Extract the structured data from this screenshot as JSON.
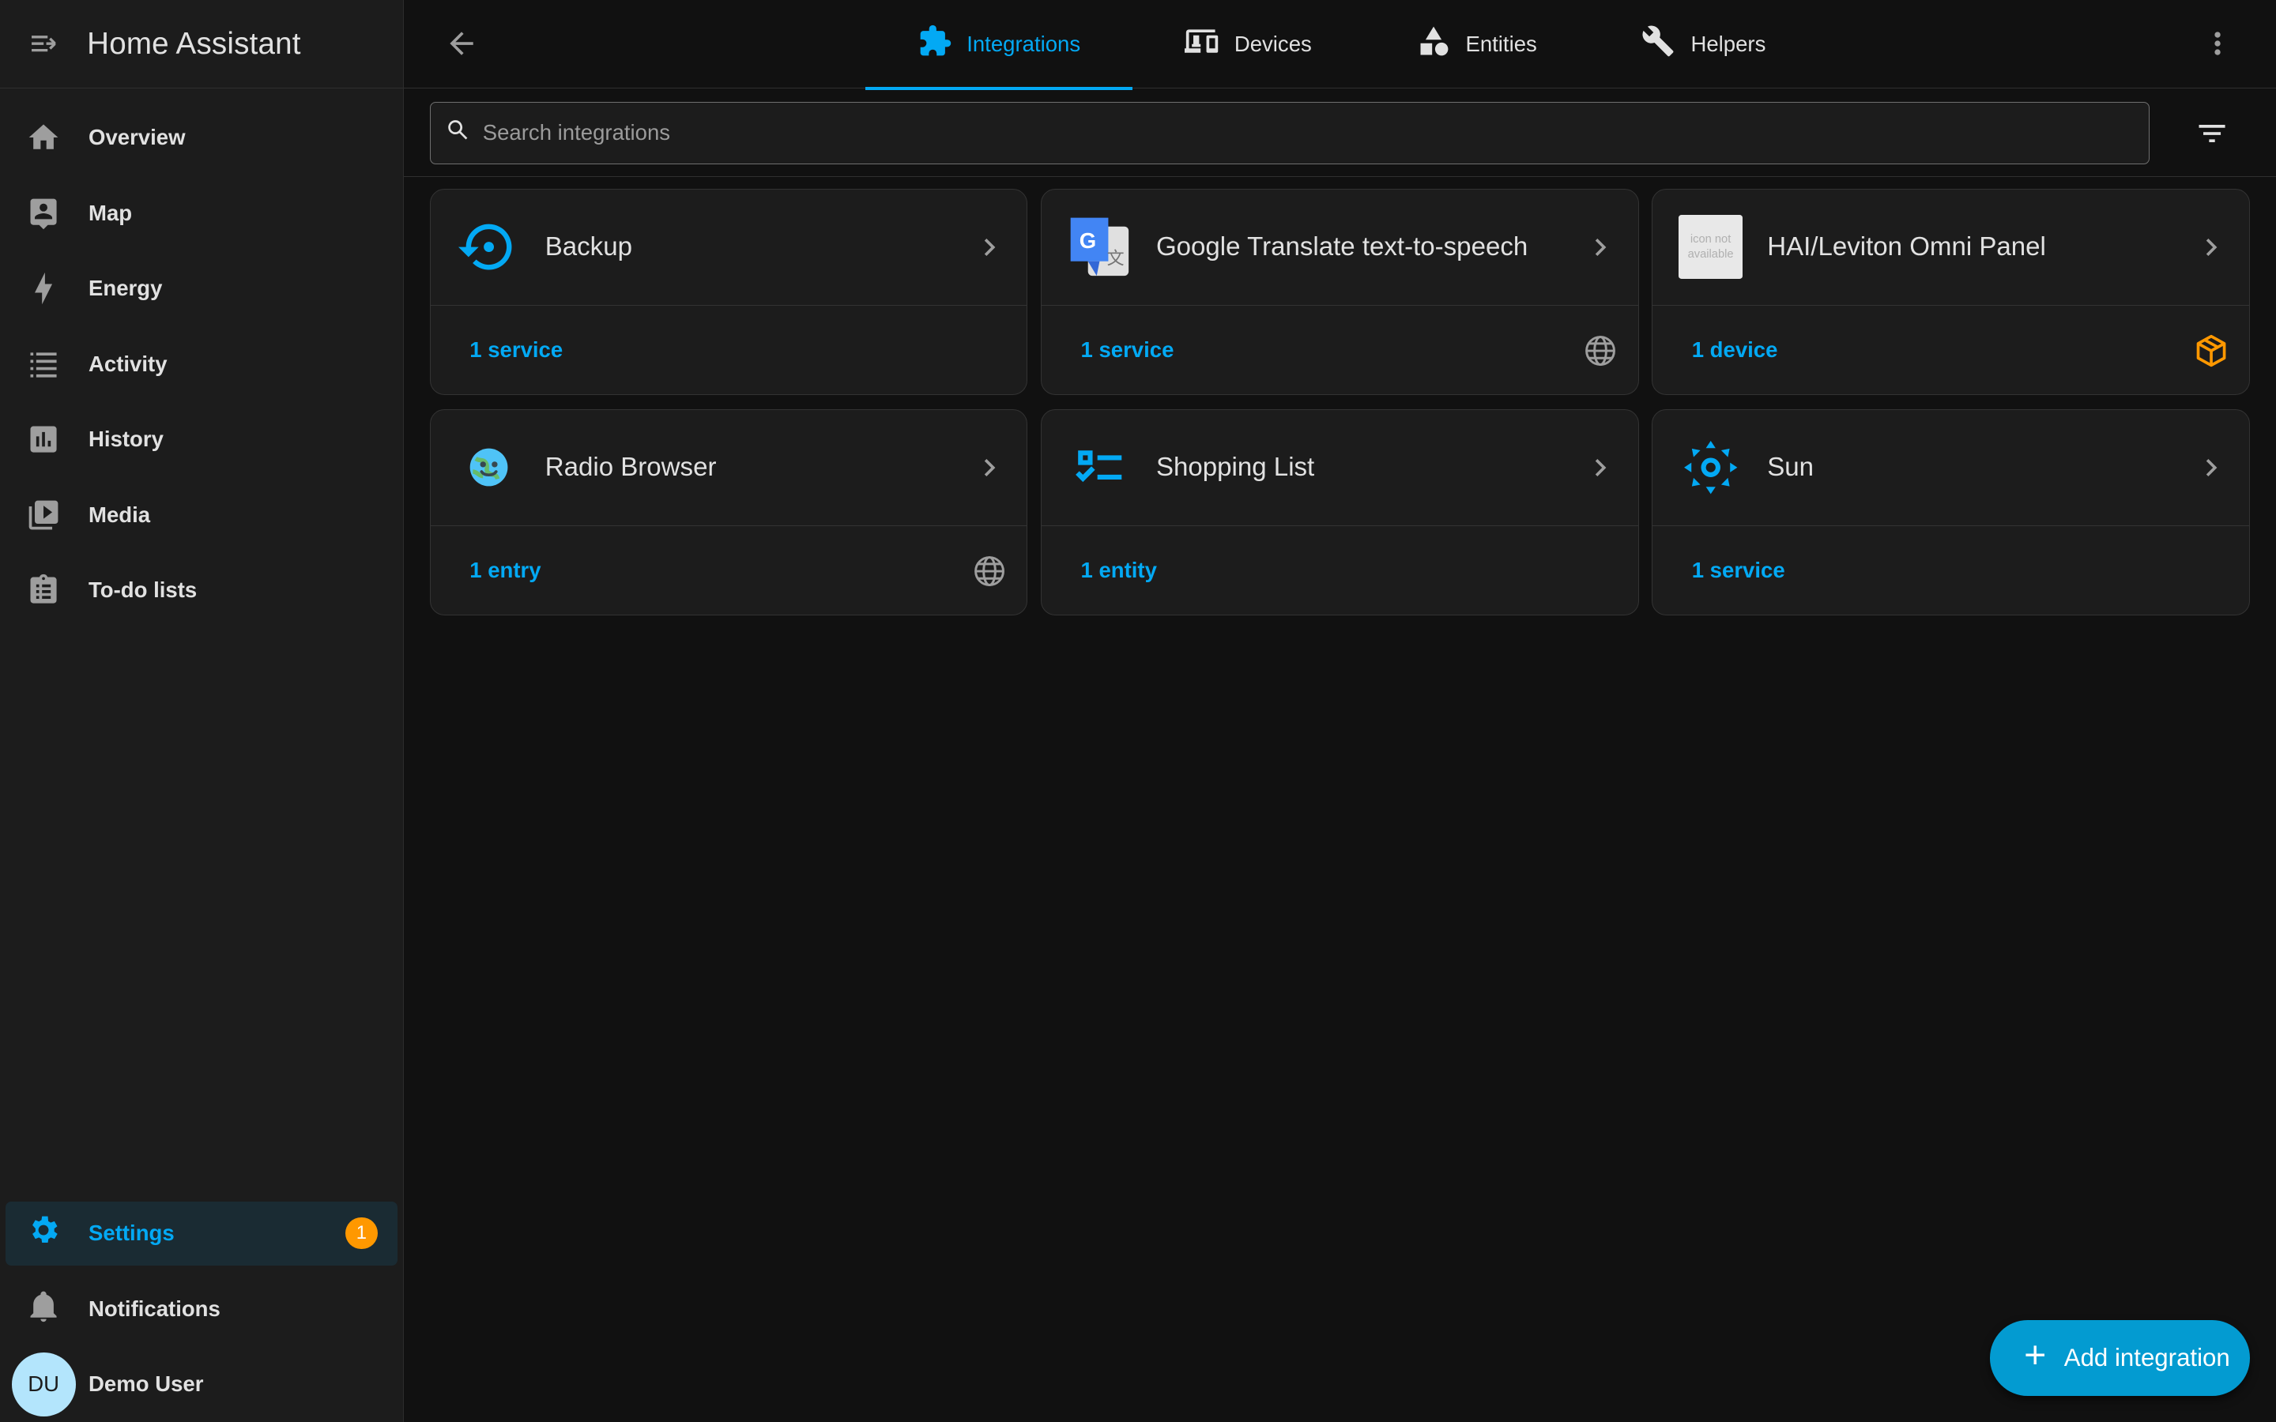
{
  "sidebar": {
    "title": "Home Assistant",
    "items": [
      {
        "label": "Overview",
        "icon": "home-icon"
      },
      {
        "label": "Map",
        "icon": "map-icon"
      },
      {
        "label": "Energy",
        "icon": "lightning-icon"
      },
      {
        "label": "Activity",
        "icon": "list-icon"
      },
      {
        "label": "History",
        "icon": "chart-icon"
      },
      {
        "label": "Media",
        "icon": "media-icon"
      },
      {
        "label": "To-do lists",
        "icon": "clipboard-icon"
      }
    ],
    "settings": {
      "label": "Settings",
      "badge": "1"
    },
    "notifications": {
      "label": "Notifications"
    },
    "user": {
      "initials": "DU",
      "name": "Demo User"
    }
  },
  "tabs": [
    {
      "label": "Integrations",
      "active": true
    },
    {
      "label": "Devices",
      "active": false
    },
    {
      "label": "Entities",
      "active": false
    },
    {
      "label": "Helpers",
      "active": false
    }
  ],
  "search": {
    "placeholder": "Search integrations",
    "value": ""
  },
  "cards": [
    {
      "name": "Backup",
      "link": "1 service",
      "logo": "backup-icon",
      "badge": ""
    },
    {
      "name": "Google Translate text-to-speech",
      "link": "1 service",
      "logo": "google-translate-icon",
      "badge": "cloud-globe-icon"
    },
    {
      "name": "HAI/Leviton Omni Panel",
      "link": "1 device",
      "logo": "icon-not-available-placeholder",
      "logo_text": "icon not available",
      "badge": "custom-package-icon"
    },
    {
      "name": "Radio Browser",
      "link": "1 entry",
      "logo": "radio-browser-icon",
      "badge": "cloud-globe-icon"
    },
    {
      "name": "Shopping List",
      "link": "1 entity",
      "logo": "shopping-list-icon",
      "badge": ""
    },
    {
      "name": "Sun",
      "link": "1 service",
      "logo": "sun-icon",
      "badge": ""
    }
  ],
  "fab": {
    "label": "Add integration"
  },
  "colors": {
    "accent": "#03a9f4",
    "badge": "#ff9800",
    "background": "#111111",
    "sidebar": "#1c1c1c"
  }
}
